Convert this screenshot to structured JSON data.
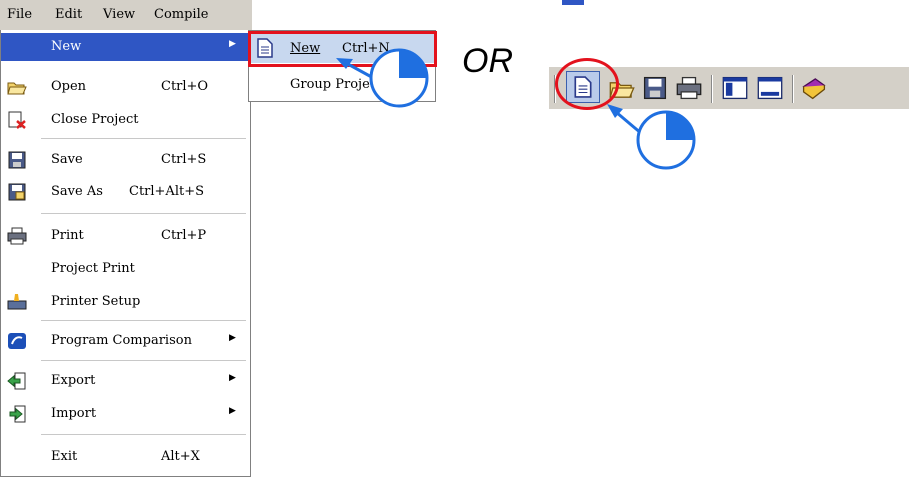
{
  "menubar": {
    "items": [
      "File",
      "Edit",
      "View",
      "Compile"
    ]
  },
  "file_menu": {
    "items": [
      {
        "label": "New",
        "shortcut": "",
        "submenu": true,
        "icon": ""
      },
      {
        "label": "Open",
        "shortcut": "Ctrl+O",
        "submenu": false,
        "icon": "open-folder-icon"
      },
      {
        "label": "Close Project",
        "shortcut": "",
        "submenu": false,
        "icon": "close-project-icon"
      },
      {
        "label": "Save",
        "shortcut": "Ctrl+S",
        "submenu": false,
        "icon": "floppy-disk-icon"
      },
      {
        "label": "Save As",
        "shortcut": "Ctrl+Alt+S",
        "submenu": false,
        "icon": "save-as-icon"
      },
      {
        "label": "Print",
        "shortcut": "Ctrl+P",
        "submenu": false,
        "icon": "printer-icon"
      },
      {
        "label": "Project Print",
        "shortcut": "",
        "submenu": false,
        "icon": ""
      },
      {
        "label": "Printer Setup",
        "shortcut": "",
        "submenu": false,
        "icon": "printer-setup-icon"
      },
      {
        "label": "Program Comparison",
        "shortcut": "",
        "submenu": true,
        "icon": "compare-icon"
      },
      {
        "label": "Export",
        "shortcut": "",
        "submenu": true,
        "icon": "export-icon"
      },
      {
        "label": "Import",
        "shortcut": "",
        "submenu": true,
        "icon": "import-icon"
      },
      {
        "label": "Exit",
        "shortcut": "Alt+X",
        "submenu": false,
        "icon": ""
      }
    ]
  },
  "submenu": {
    "new_label": "New",
    "new_shortcut": "Ctrl+N",
    "group_label": "Group Project"
  },
  "or_text": "OR",
  "toolbar": {
    "icons": [
      "new-file-icon",
      "open-folder-icon",
      "floppy-disk-icon",
      "printer-icon",
      "panel-icon",
      "window-icon",
      "help-book-icon"
    ]
  },
  "colors": {
    "highlight": "#2f56c4",
    "annotation_red": "#e3121d",
    "annotation_blue": "#1f6fe0"
  }
}
